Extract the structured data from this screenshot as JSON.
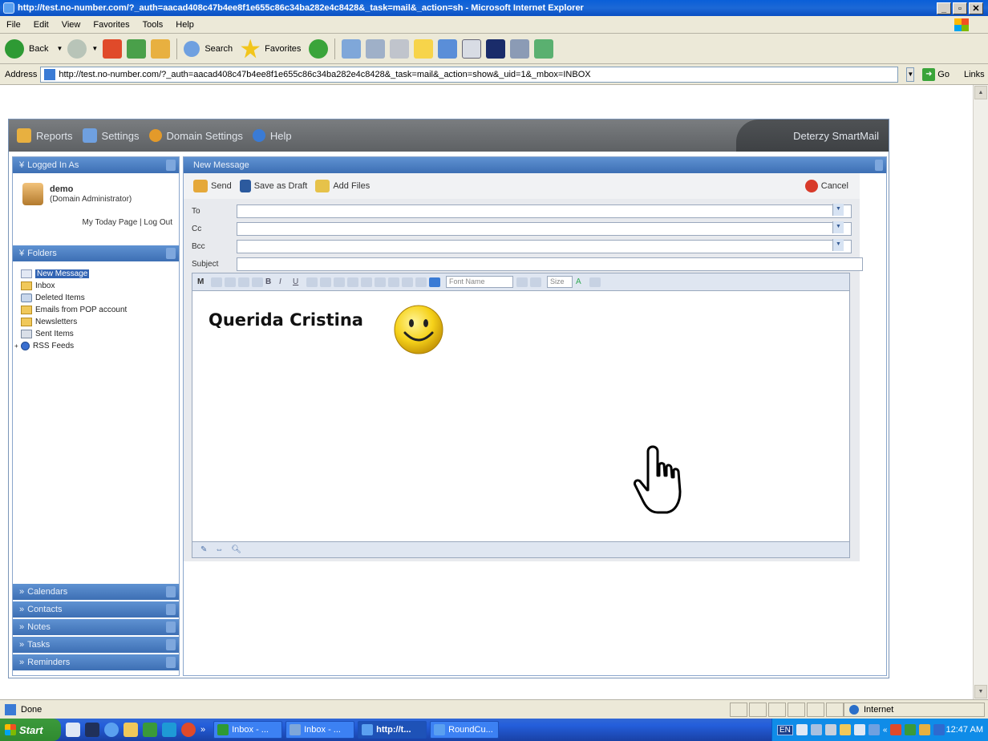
{
  "window": {
    "title": "http://test.no-number.com/?_auth=aacad408c47b4ee8f1e655c86c34ba282e4c8428&_task=mail&_action=sh - Microsoft Internet Explorer",
    "controls": [
      "_",
      "̶",
      "x"
    ]
  },
  "menubar": {
    "items": [
      "File",
      "Edit",
      "View",
      "Favorites",
      "Tools",
      "Help"
    ]
  },
  "toolbar": {
    "back": "Back",
    "search": "Search",
    "favorites": "Favorites"
  },
  "address": {
    "label": "Address",
    "url": "http://test.no-number.com/?_auth=aacad408c47b4ee8f1e655c86c34ba282e4c8428&_task=mail&_action=show&_uid=1&_mbox=INBOX",
    "go": "Go",
    "links": "Links"
  },
  "app": {
    "nav": {
      "reports": "Reports",
      "settings": "Settings",
      "domain_settings": "Domain Settings",
      "help": "Help"
    },
    "brand": "Deterzy SmartMail",
    "sidebar": {
      "logged_in_header": "Logged In As",
      "user": "demo",
      "role": "(Domain Administrator)",
      "links": "My Today Page | Log Out",
      "folders_header": "Folders",
      "folders": [
        {
          "label": "New Message",
          "icon": "draft-icon",
          "selected": true
        },
        {
          "label": "Inbox",
          "icon": "folder-icon",
          "selected": false
        },
        {
          "label": "Deleted Items",
          "icon": "trash-icon",
          "selected": false
        },
        {
          "label": "Emails from POP account",
          "icon": "folder-icon",
          "selected": false
        },
        {
          "label": "Newsletters",
          "icon": "folder-icon",
          "selected": false
        },
        {
          "label": "Sent Items",
          "icon": "sent-icon",
          "selected": false
        },
        {
          "label": "RSS Feeds",
          "icon": "rss-icon",
          "selected": false
        }
      ],
      "bottom_sections": [
        "Calendars",
        "Contacts",
        "Notes",
        "Tasks",
        "Reminders"
      ]
    },
    "compose": {
      "header": "New Message",
      "send": "Send",
      "save_draft": "Save as Draft",
      "add_files": "Add Files",
      "cancel": "Cancel",
      "to_label": "To",
      "cc_label": "Cc",
      "bcc_label": "Bcc",
      "subject_label": "Subject",
      "to_value": "",
      "cc_value": "",
      "bcc_value": "",
      "subject_value": "",
      "font_name_placeholder": "Font Name",
      "size_placeholder": "Size",
      "body_text": "Querida Cristina"
    }
  },
  "statusbar": {
    "status": "Done",
    "zone": "Internet"
  },
  "taskbar": {
    "start": "Start",
    "tasks": [
      {
        "label": "Inbox - ...",
        "active": false
      },
      {
        "label": "Inbox - ...",
        "active": false
      },
      {
        "label": "http://t...",
        "active": true
      },
      {
        "label": "RoundCu...",
        "active": false
      }
    ],
    "lang": "EN",
    "clock": "12:47 AM"
  },
  "colors": {
    "xp_blue": "#0a5fd8",
    "panel_header": "#3d6fb4",
    "app_header": "#5e6164"
  }
}
